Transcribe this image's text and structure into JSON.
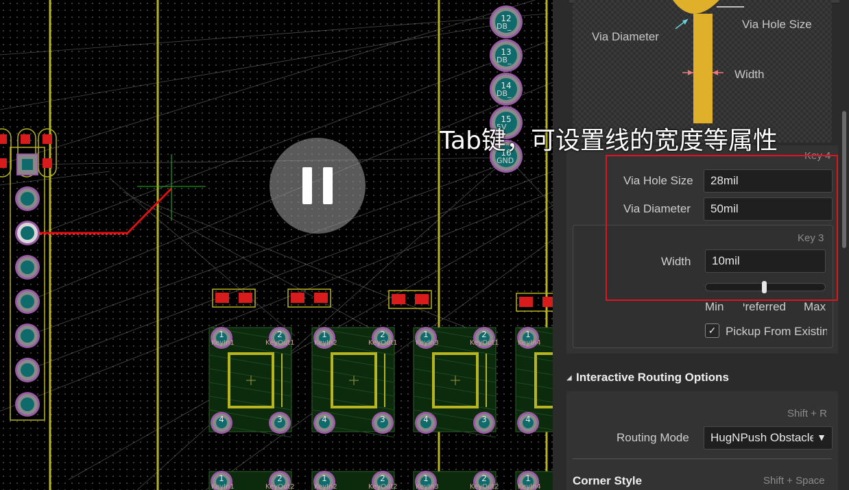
{
  "overlay": {
    "caption": "Tab键，可设置线的宽度等属性"
  },
  "pcb": {
    "pad_numbers_top": [
      "12",
      "13",
      "14",
      "15",
      "16"
    ],
    "pad_labels_top": [
      "DB_",
      "DB_",
      "DB_",
      "5V",
      "GND"
    ],
    "switch_pad_numbers": [
      "1",
      "2",
      "4",
      "3"
    ],
    "switch_labels_row1": [
      "KeyIn1",
      "KeyOut1",
      "KeyIn2",
      "KeyOut1",
      "KeyIn3",
      "KeyOut1",
      "KeyIn4"
    ],
    "switch_labels_row2": [
      "KeyIn1",
      "KeyOut2",
      "KeyIn2",
      "KeyOut2",
      "KeyIn3",
      "KeyOut2",
      "KeyIn4"
    ],
    "colors": {
      "outline": "#b8b420",
      "pad": "#0f6b6b",
      "pad_ring": "#9a5aa5",
      "track": "#e01010",
      "crosshair": "#20c020"
    }
  },
  "panel": {
    "diagram": {
      "via_diameter": "Via Diameter",
      "via_hole_size": "Via Hole Size",
      "width": "Width"
    },
    "key4": "Key 4",
    "via_hole_size": {
      "label": "Via Hole Size",
      "value": "28mil"
    },
    "via_diameter": {
      "label": "Via Diameter",
      "value": "50mil"
    },
    "key3": "Key 3",
    "width": {
      "label": "Width",
      "value": "10mil"
    },
    "slider_labels": {
      "min": "Min",
      "preferred": "Preferred",
      "max": "Max"
    },
    "pickup": {
      "label": "Pickup From Existing Routes",
      "checked": true
    },
    "section_interactive": "Interactive Routing Options",
    "shift_r": "Shift + R",
    "routing_mode": {
      "label": "Routing Mode",
      "value": "HugNPush Obstacles"
    },
    "corner_style": {
      "label": "Corner Style",
      "shortcut": "Shift + Space"
    }
  },
  "colors": {
    "highlight": "#e0141e",
    "accent_gold": "#e0b02a"
  }
}
